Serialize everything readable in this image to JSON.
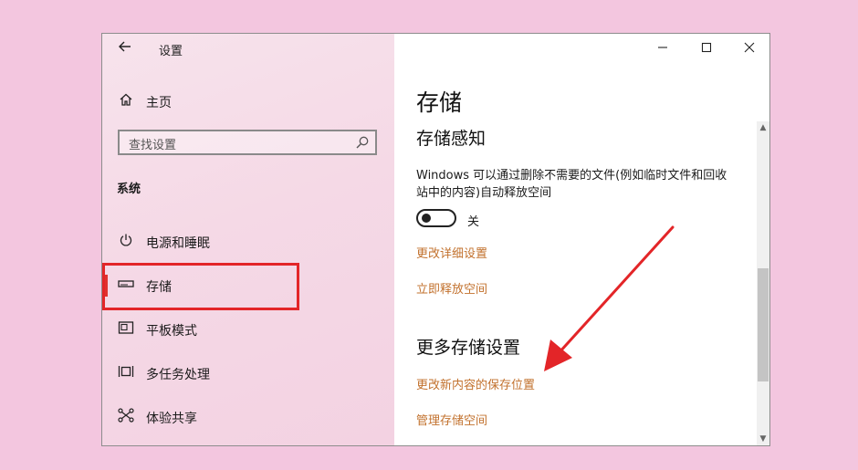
{
  "window": {
    "title": "设置"
  },
  "sidebar": {
    "home_label": "主页",
    "search_placeholder": "查找设置",
    "section_title": "系统",
    "items": [
      {
        "label": "电源和睡眠",
        "icon": "power-icon"
      },
      {
        "label": "存储",
        "icon": "storage-icon",
        "active": true
      },
      {
        "label": "平板模式",
        "icon": "tablet-mode-icon"
      },
      {
        "label": "多任务处理",
        "icon": "multitasking-icon"
      },
      {
        "label": "体验共享",
        "icon": "shared-experiences-icon"
      }
    ]
  },
  "main": {
    "page_title": "存储",
    "storage_sense": {
      "heading": "存储感知",
      "description": "Windows 可以通过删除不需要的文件(例如临时文件和回收站中的内容)自动释放空间",
      "toggle_state": "关",
      "toggle_on": false,
      "links": [
        "更改详细设置",
        "立即释放空间"
      ]
    },
    "more_storage": {
      "heading": "更多存储设置",
      "links": [
        "更改新内容的保存位置",
        "管理存储空间"
      ]
    }
  },
  "colors": {
    "background": "#f3c6df",
    "sidebar": "#f5dbe7",
    "link": "#c2712d",
    "annotation": "#e32528"
  }
}
